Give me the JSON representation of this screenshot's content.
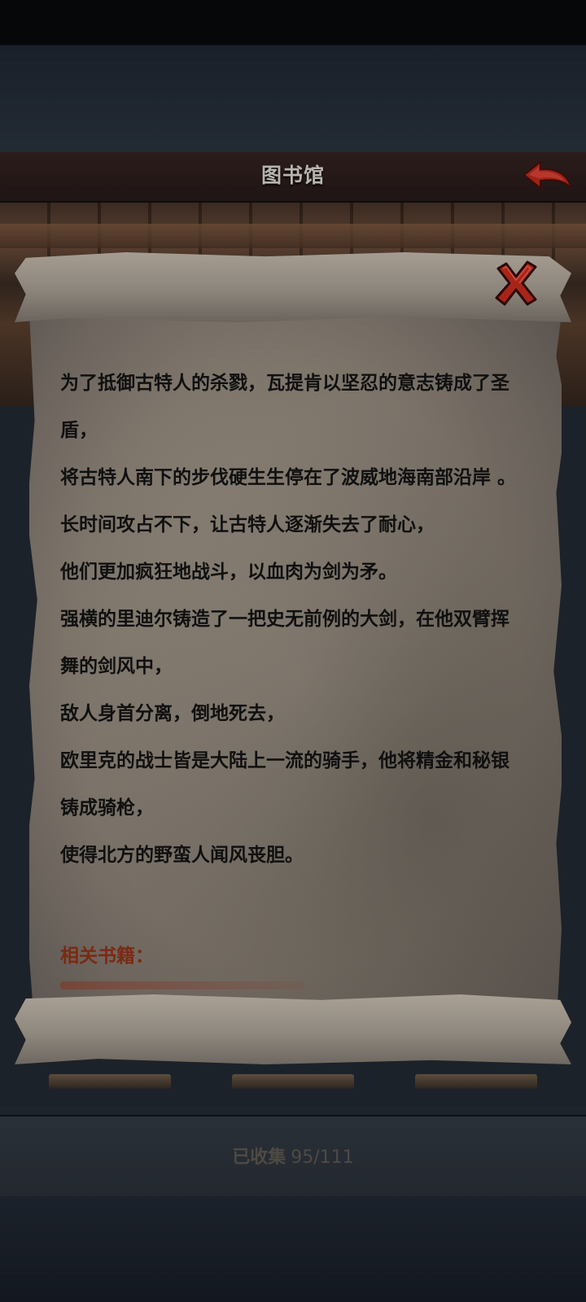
{
  "header": {
    "title": "图书馆"
  },
  "scroll": {
    "paragraphs": [
      "为了抵御古特人的杀戮，瓦提肯以坚忍的意志铸成了圣盾，",
      "将古特人南下的步伐硬生生停在了波威地海南部沿岸 。",
      "长时间攻占不下，让古特人逐渐失去了耐心，",
      "他们更加疯狂地战斗，以血肉为剑为矛。",
      "强横的里迪尔铸造了一把史无前例的大剑，在他双臂挥舞的剑风中，",
      "敌人身首分离，倒地死去，",
      "欧里克的战士皆是大陆上一流的骑手，他将精金和秘银铸成骑枪，",
      "使得北方的野蛮人闻风丧胆。"
    ],
    "related_label": "相关书籍："
  },
  "footer": {
    "collected_label": "已收集",
    "collected_count": "95/111"
  },
  "icons": {
    "back": "back-arrow-icon",
    "close": "close-x-icon"
  },
  "colors": {
    "accent_red": "#b0281a",
    "related_text": "#7a2a12",
    "scroll_text": "#101010"
  }
}
